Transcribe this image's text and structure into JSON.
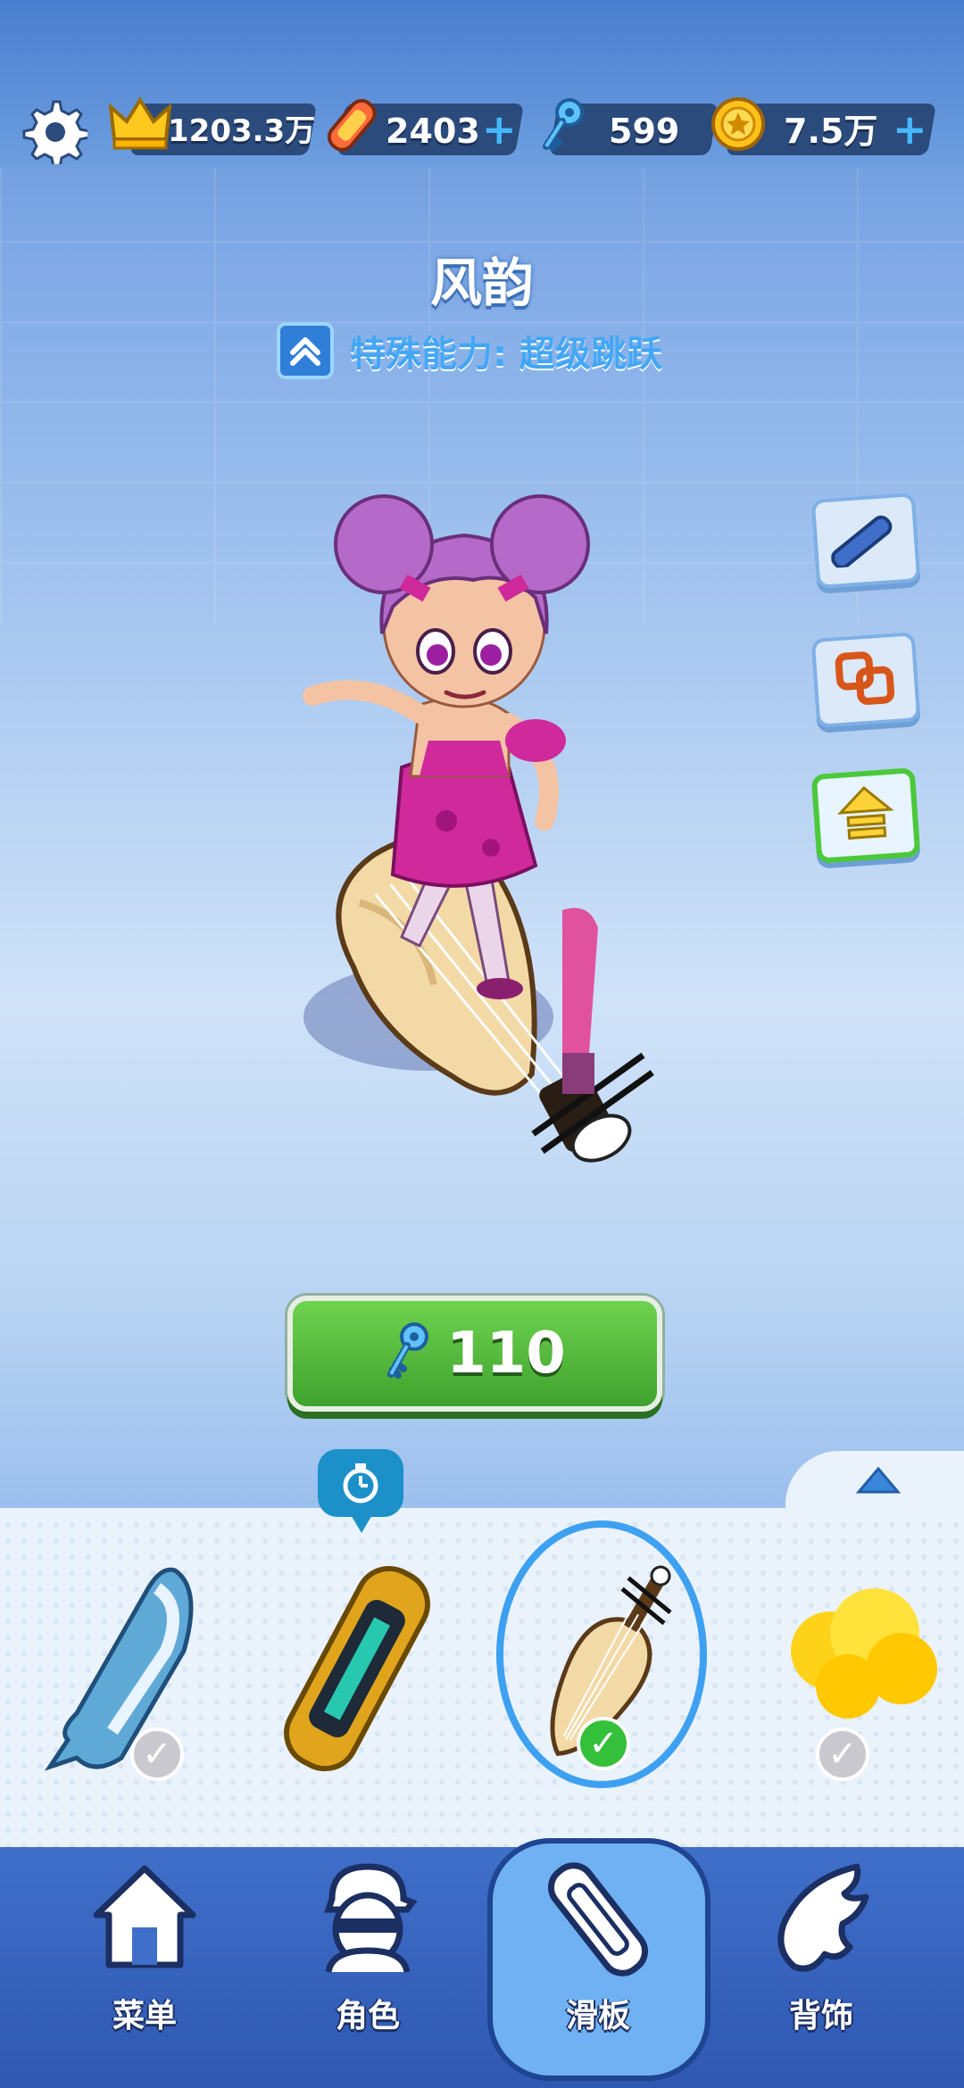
{
  "top_bar": {
    "settings_icon": "gear-icon",
    "crown": {
      "icon": "crown-icon",
      "value": "1203.3万"
    },
    "boards": {
      "icon": "hoverboard-icon",
      "value": "2403",
      "plus": "+"
    },
    "keys": {
      "icon": "key-icon",
      "value": "599"
    },
    "coins": {
      "icon": "coin-icon",
      "value": "7.5万",
      "plus": "+"
    }
  },
  "board": {
    "name": "风韵",
    "ability_icon": "double-chevron-up-icon",
    "ability": "特殊能力: 超级跳跃"
  },
  "side_buttons": [
    "board-icon",
    "link-icon",
    "upgrade-arrow-icon"
  ],
  "buy": {
    "icon": "key-icon",
    "price": "110"
  },
  "selector": {
    "collapse_icon": "triangle-up-icon",
    "timer_icon": "stopwatch-icon",
    "items": [
      {
        "name": "whale-board",
        "owned": true,
        "selected": false
      },
      {
        "name": "golden-board",
        "owned": false,
        "selected": false
      },
      {
        "name": "pipa-board",
        "owned": true,
        "selected": true
      },
      {
        "name": "yellow-cloud-board",
        "owned": true,
        "selected": false
      }
    ]
  },
  "nav": {
    "items": [
      {
        "label": "菜单",
        "icon": "home-icon"
      },
      {
        "label": "角色",
        "icon": "character-icon"
      },
      {
        "label": "滑板",
        "icon": "hoverboard-icon"
      },
      {
        "label": "背饰",
        "icon": "wings-icon"
      }
    ],
    "active": "滑板"
  },
  "colors": {
    "accent_green": "#4cc93a",
    "accent_blue": "#3ea0f0",
    "nav_blue": "#2f58b2"
  }
}
